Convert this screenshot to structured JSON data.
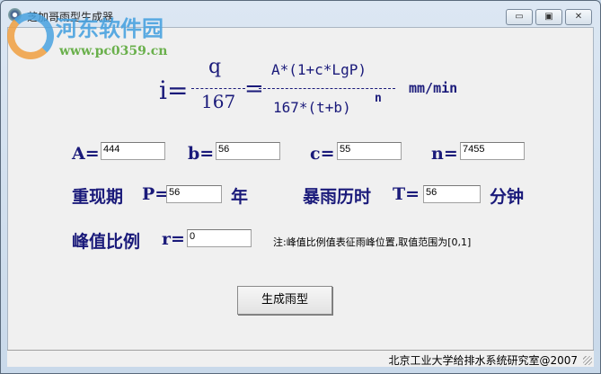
{
  "window": {
    "title": "芝加哥雨型生成器",
    "minimize": "▭",
    "maximize": "▣",
    "close": "✕"
  },
  "watermark": {
    "name": "河东软件园",
    "url": "www.pc0359.cn"
  },
  "formula": {
    "lhs": "i=",
    "num1": "q",
    "den1": "167",
    "eq2": "=",
    "num2": "A*(1+c*LgP)",
    "den2": "167*(t+b)",
    "exp": "n",
    "unit": "mm/min"
  },
  "params": {
    "A": {
      "label": "A=",
      "value": "444"
    },
    "b": {
      "label": "b=",
      "value": "56"
    },
    "c": {
      "label": "c=",
      "value": "55"
    },
    "n": {
      "label": "n=",
      "value": "7455"
    }
  },
  "period": {
    "label": "重现期",
    "var": "P=",
    "value": "56",
    "unit": "年"
  },
  "duration": {
    "label": "暴雨历时",
    "var": "T=",
    "value": "56",
    "unit": "分钟"
  },
  "peak": {
    "label": "峰值比例",
    "var": "r=",
    "value": "0",
    "note": "注:峰值比例值表征雨峰位置,取值范围为[0,1]"
  },
  "generate_button": "生成雨型",
  "status": "北京工业大学给排水系统研究室@2007"
}
